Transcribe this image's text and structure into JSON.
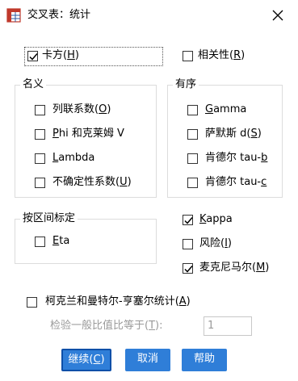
{
  "window": {
    "title": "交叉表：统计"
  },
  "chisq": {
    "label_pre": "卡方(",
    "label_key": "H",
    "label_post": ")",
    "checked": true
  },
  "correlations": {
    "label_pre": "相关性(",
    "label_key": "R",
    "label_post": ")",
    "checked": false
  },
  "nominal": {
    "title": "名义",
    "items": [
      {
        "pre": "列联系数(",
        "key": "O",
        "post": ")",
        "checked": false
      },
      {
        "pre": "",
        "key": "P",
        "post": "hi 和克莱姆 V",
        "checked": false
      },
      {
        "pre": "",
        "key": "L",
        "post": "ambda",
        "checked": false
      },
      {
        "pre": "不确定性系数(",
        "key": "U",
        "post": ")",
        "checked": false
      }
    ]
  },
  "ordinal": {
    "title": "有序",
    "items": [
      {
        "pre": "",
        "key": "G",
        "post": "amma",
        "checked": false
      },
      {
        "pre": "萨默斯 d(",
        "key": "S",
        "post": ")",
        "checked": false
      },
      {
        "pre": "肯德尔 tau-",
        "key": "b",
        "post": "",
        "checked": false
      },
      {
        "pre": "肯德尔 tau-",
        "key": "c",
        "post": "",
        "checked": false
      }
    ]
  },
  "nominal_by_interval": {
    "title": "按区间标定",
    "eta": {
      "pre": "",
      "key": "E",
      "post": "ta",
      "checked": false
    }
  },
  "kappa": {
    "pre": "",
    "key": "K",
    "post": "appa",
    "checked": true
  },
  "risk": {
    "pre": "风险(",
    "key": "I",
    "post": ")",
    "checked": false
  },
  "mcnemar": {
    "pre": "麦克尼马尔(",
    "key": "M",
    "post": ")",
    "checked": true
  },
  "cmh": {
    "pre": "柯克兰和曼特尔-亨塞尔统计(",
    "key": "A",
    "post": ")",
    "checked": false,
    "test_label_pre": "检验一般比值比等于(",
    "test_label_key": "T",
    "test_label_post": "):",
    "test_value": "1"
  },
  "buttons": {
    "continue": {
      "pre": "继续(",
      "key": "C",
      "post": ")"
    },
    "cancel": "取消",
    "help": "帮助"
  },
  "colors": {
    "accent": "#2f7ed8",
    "accent_border": "#0d4fa8"
  }
}
